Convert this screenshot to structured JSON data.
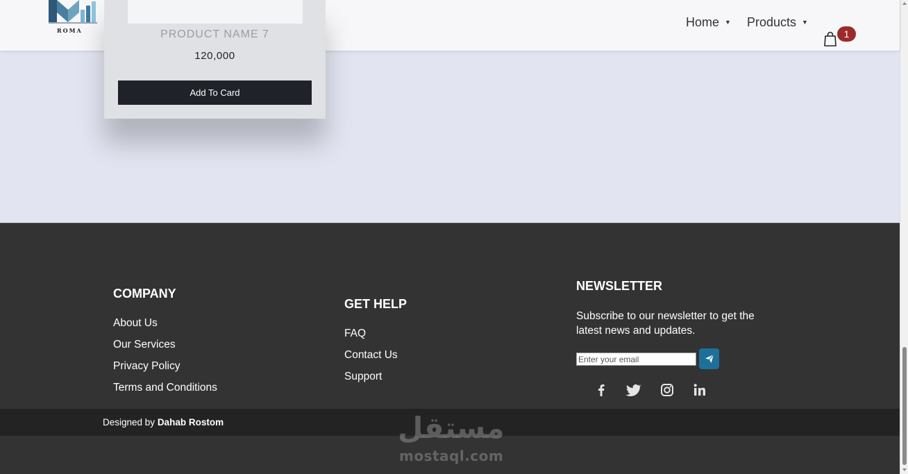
{
  "header": {
    "logo_text": "ROMA",
    "nav": [
      {
        "label": "Home",
        "icon": "caret-down-icon"
      },
      {
        "label": "Products",
        "icon": "caret-down-icon"
      }
    ],
    "cart": {
      "icon": "shopping-bag-icon",
      "count": "1"
    }
  },
  "product_card": {
    "name": "PRODUCT NAME 7",
    "price": "120,000",
    "button_label": "Add To Card"
  },
  "footer": {
    "company": {
      "title": "COMPANY",
      "links": [
        "About Us",
        "Our Services",
        "Privacy Policy",
        "Terms and Conditions"
      ]
    },
    "help": {
      "title": "GET HELP",
      "links": [
        "FAQ",
        "Contact Us",
        "Support"
      ]
    },
    "newsletter": {
      "title": "NEWSLETTER",
      "text": "Subscribe to our newsletter to get the latest news and updates.",
      "input_placeholder": "Enter your email",
      "button_icon": "send-icon"
    },
    "social": [
      "facebook-icon",
      "twitter-icon",
      "instagram-icon",
      "linkedin-icon"
    ],
    "credit": {
      "prefix": "Designed by ",
      "author": "Dahab Rostom"
    }
  },
  "watermark": {
    "arabic": "مستقل",
    "latin": "mostaql.com"
  },
  "colors": {
    "footer_bg": "#333333",
    "badge": "#9b2b2b",
    "send_button": "#1e6f9a",
    "page_bg": "#e2e5f1"
  }
}
